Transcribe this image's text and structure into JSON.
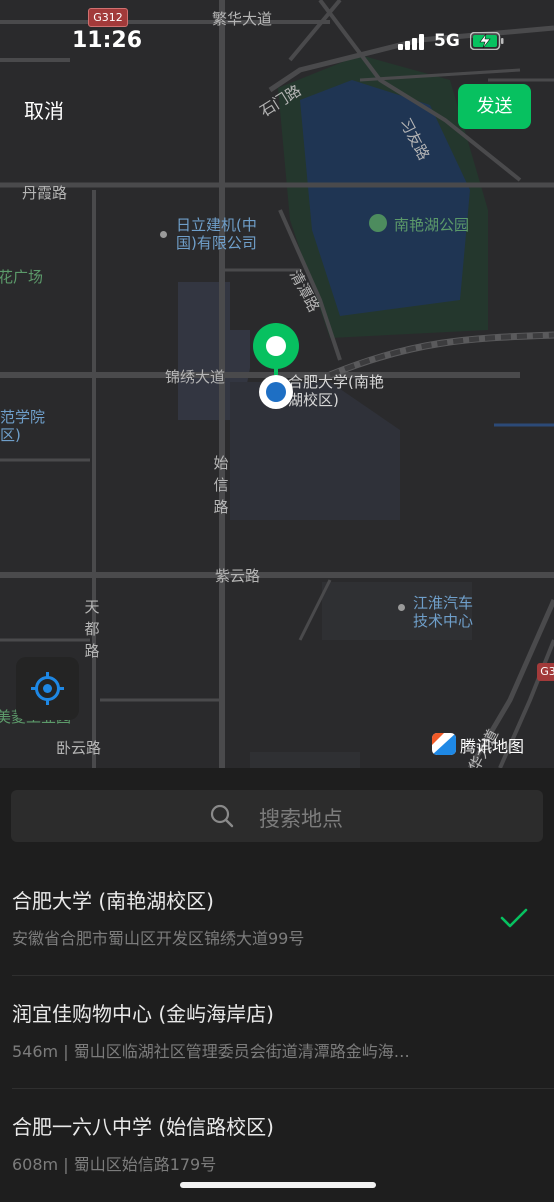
{
  "status_bar": {
    "time": "11:26",
    "network": "5G"
  },
  "header": {
    "cancel_label": "取消",
    "send_label": "发送"
  },
  "map": {
    "labels": {
      "g312": "G312",
      "fanhua": "繁华大道",
      "shimen": "石门路",
      "xiyou": "习友路",
      "danxia": "丹霞路",
      "hitachi": "日立建机(中国)有限公司",
      "park": "南艳湖公园",
      "plaza": "花广场",
      "qingtan": "清潭路",
      "jinxiu": "锦绣大道",
      "hfu": "合肥大学(南艳湖校区)",
      "normal": "范学院区)",
      "shixin": "始信路",
      "ziyun": "紫云路",
      "jac": "江淮汽车技术中心",
      "tiandu": "天都路",
      "wopark": "美菱工业园",
      "woyun": "卧云路",
      "g3": "G3",
      "road_br": "繁华大道"
    },
    "brand": "腾讯地图",
    "marker_color": "#07c160"
  },
  "search": {
    "placeholder": "搜索地点"
  },
  "places": [
    {
      "title": "合肥大学 (南艳湖校区)",
      "address": "安徽省合肥市蜀山区开发区锦绣大道99号",
      "selected": true
    },
    {
      "title": "润宜佳购物中心 (金屿海岸店)",
      "address": "546m | 蜀山区临湖社区管理委员会街道清潭路金屿海…",
      "selected": false
    },
    {
      "title": "合肥一六八中学 (始信路校区)",
      "address": "608m | 蜀山区始信路179号",
      "selected": false
    }
  ],
  "colors": {
    "accent": "#07c160",
    "locate_blue": "#1e88e5"
  },
  "icons": [
    "signal-icon",
    "battery-charging-icon",
    "locate-icon",
    "search-icon",
    "check-icon",
    "map-pin-icon",
    "tencent-logo-icon"
  ]
}
